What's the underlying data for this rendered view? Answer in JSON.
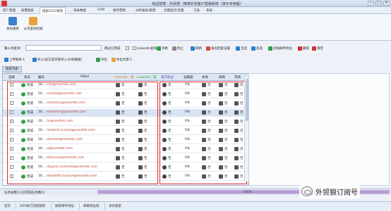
{
  "window": {
    "title": "商品智慧 · 外贸搜 · 精准外贸客户营销系统（演示专用版）",
    "controls": [
      "—",
      "□",
      "✕"
    ]
  },
  "menu": {
    "items": [
      "客户管理",
      "按需搜索",
      "搜索CEO/采购",
      "海关数据",
      "CRM",
      "邮件营销",
      "分析报表/图谱",
      "流量监控/流量",
      "工具",
      "系统"
    ],
    "active_index": 2
  },
  "ribbon": {
    "buttons": [
      {
        "label": "身份搜索",
        "icon": "person-search-icon",
        "color": "#3b7fd1"
      },
      {
        "label": "公司查找挖掘",
        "icon": "company-search-icon",
        "color": "#e7a23a"
      }
    ]
  },
  "toolbar1": {
    "input_label": "输入待查询：",
    "input_value": "",
    "checkbox_label": "跳过已完成",
    "linkedin_label": "LinkedIn查询",
    "buttons": [
      {
        "label": "开始",
        "icon": "play-icon",
        "color": "#2e9e44"
      },
      {
        "label": "停止",
        "icon": "stop-icon",
        "color": "#888888"
      },
      {
        "label": "刷新",
        "icon": "refresh-icon",
        "color": "#2d7bd2"
      },
      {
        "label": "备份回复设置",
        "icon": "backup-icon",
        "color": "#d14a3b"
      },
      {
        "label": "全选",
        "icon": "select-all-icon",
        "color": "#2d7bd2"
      },
      {
        "label": "反选",
        "icon": "invert-select-icon",
        "color": "#2d7bd2"
      },
      {
        "label": "添加邮件地址",
        "icon": "add-email-icon",
        "color": "#2e9e44"
      },
      {
        "label": "删除",
        "icon": "delete-icon",
        "color": "#d33030"
      },
      {
        "label": "清空",
        "icon": "clear-icon",
        "color": "#d33030"
      }
    ]
  },
  "toolbar2": {
    "buttons": [
      {
        "label": "上传联系人",
        "icon": "upload-icon",
        "color": "#2d7bd2"
      },
      {
        "label": "导入(此方案仅限导入30条数据)",
        "icon": "import-icon",
        "color": "#2d7bd2"
      },
      {
        "label": "导出",
        "icon": "export-icon",
        "color": "#2e9e44"
      },
      {
        "label": "导出为客人",
        "icon": "export-customer-icon",
        "color": "#e7a23a"
      }
    ]
  },
  "tab": {
    "label": "搜索列表"
  },
  "grid": {
    "columns": [
      "选择",
      "状态",
      "编号",
      "EMail",
      "LinkedIn一度",
      "LinkedIn二度",
      "是否职业",
      "准确度",
      "失败",
      "采购",
      "其他"
    ],
    "rows": [
      {
        "status": "完成",
        "id": "16...",
        "email": "info@noortek.com",
        "l1": "无",
        "l2": "无",
        "job": "无",
        "acc": "0%",
        "fail": "否",
        "buy": "否",
        "other": "否",
        "selected": false
      },
      {
        "status": "完成",
        "id": "16...",
        "email": "contato@noortek.com",
        "l1": "无",
        "l2": "无",
        "job": "无",
        "acc": "0%",
        "fail": "否",
        "buy": "否",
        "other": "否",
        "selected": false
      },
      {
        "status": "完成",
        "id": "16...",
        "email": "contactus@noortek.com",
        "l1": "无",
        "l2": "无",
        "job": "无",
        "acc": "0%",
        "fail": "否",
        "buy": "否",
        "other": "否",
        "selected": false
      },
      {
        "status": "完成",
        "id": "16...",
        "email": "marketing@noortek.com",
        "l1": "无",
        "l2": "无",
        "job": "无",
        "acc": "0%",
        "fail": "否",
        "buy": "否",
        "other": "否",
        "selected": true
      },
      {
        "status": "完成",
        "id": "16...",
        "email": "hr@noortek.com",
        "l1": "无",
        "l2": "无",
        "job": "无",
        "acc": "0%",
        "fail": "否",
        "buy": "否",
        "other": "否",
        "selected": false
      },
      {
        "status": "完成",
        "id": "16...",
        "email": "norberto.lucena@noortek.com",
        "l1": "无",
        "l2": "无",
        "job": "无",
        "acc": "0%",
        "fail": "否",
        "buy": "否",
        "other": "否",
        "selected": false
      },
      {
        "status": "完成",
        "id": "16...",
        "email": "akresen@noortek.com",
        "l1": "无",
        "l2": "无",
        "job": "无",
        "acc": "0%",
        "fail": "否",
        "buy": "否",
        "other": "否",
        "selected": false
      },
      {
        "status": "完成",
        "id": "16...",
        "email": "ol@noortek.com",
        "l1": "无",
        "l2": "无",
        "job": "无",
        "acc": "0%",
        "fail": "否",
        "buy": "否",
        "other": "否",
        "selected": false
      },
      {
        "status": "完成",
        "id": "16...",
        "email": "leitacsea@noortek.com",
        "l1": "无",
        "l2": "无",
        "job": "无",
        "acc": "0%",
        "fail": "否",
        "buy": "否",
        "other": "否",
        "selected": false
      },
      {
        "status": "完成",
        "id": "16...",
        "email": "dayane.clemente@noortek.com",
        "l1": "无",
        "l2": "无",
        "job": "无",
        "acc": "0%",
        "fail": "否",
        "buy": "否",
        "other": "否",
        "selected": false
      },
      {
        "status": "完成",
        "id": "16...",
        "email": "elizabeth.busque@noortek.com",
        "l1": "无",
        "l2": "无",
        "job": "无",
        "acc": "0%",
        "fail": "否",
        "buy": "否",
        "other": "否",
        "selected": false
      }
    ]
  },
  "status": {
    "text": "任务总数11/已完成任务数11",
    "progress_percent": 100,
    "progress_label": "100%"
  },
  "taskbar": {
    "items": [
      "首页",
      "SOS执行流程跟踪",
      "搜索邮件地址",
      "邮箱地址统",
      "身份搜索"
    ]
  },
  "watermark": {
    "text": "外贸狼订阅号"
  },
  "colors": {
    "accent": "#3b7fd1",
    "ok": "#2e9e44",
    "highlight_box": "#e0282e",
    "email_text": "#c0392b"
  }
}
